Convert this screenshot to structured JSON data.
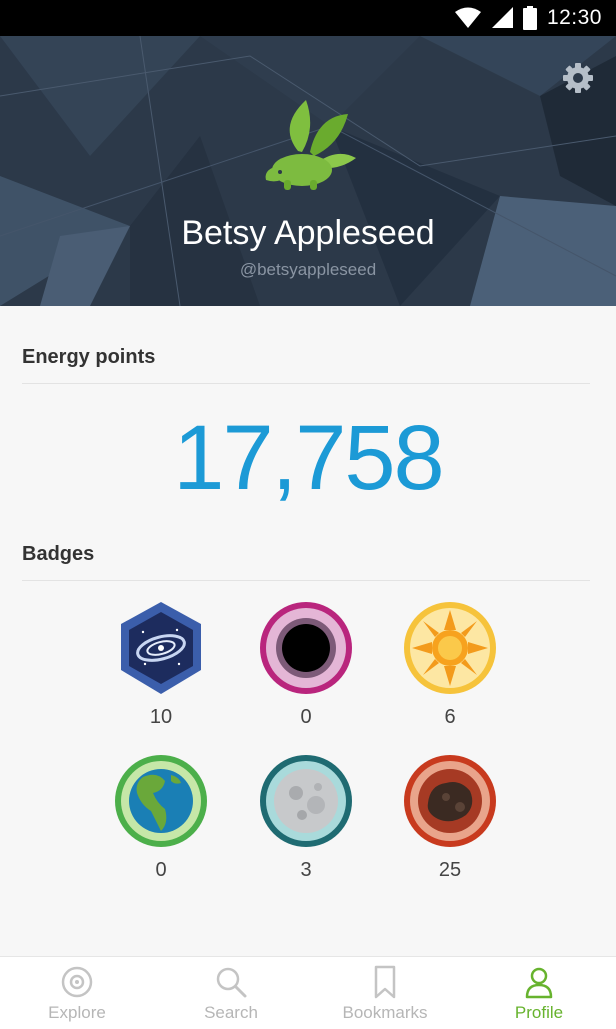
{
  "status_bar": {
    "time": "12:30"
  },
  "profile": {
    "name": "Betsy Appleseed",
    "handle": "@betsyappleseed"
  },
  "energy": {
    "title": "Energy points",
    "value": "17,758",
    "color": "#1c9ad6"
  },
  "badges": {
    "title": "Badges",
    "items": [
      {
        "icon": "galaxy-badge-icon",
        "count": "10"
      },
      {
        "icon": "black-hole-badge-icon",
        "count": "0"
      },
      {
        "icon": "sun-badge-icon",
        "count": "6"
      },
      {
        "icon": "earth-badge-icon",
        "count": "0"
      },
      {
        "icon": "moon-badge-icon",
        "count": "3"
      },
      {
        "icon": "asteroid-badge-icon",
        "count": "25"
      }
    ]
  },
  "nav": {
    "items": [
      {
        "label": "Explore",
        "icon": "explore-icon"
      },
      {
        "label": "Search",
        "icon": "search-icon"
      },
      {
        "label": "Bookmarks",
        "icon": "bookmark-icon"
      },
      {
        "label": "Profile",
        "icon": "profile-icon",
        "active": true
      }
    ],
    "active_color": "#67b32e",
    "inactive_color": "#b6b6b6"
  }
}
